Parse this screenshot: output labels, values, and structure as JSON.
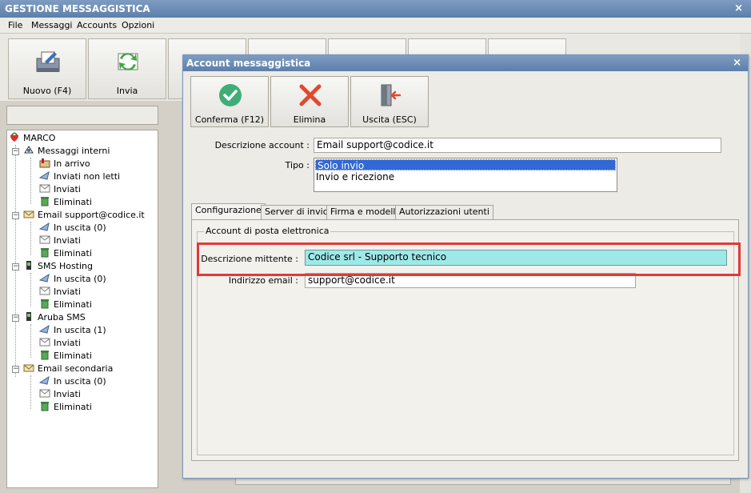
{
  "main_window": {
    "title": "GESTIONE MESSAGGISTICA",
    "close_label": "×"
  },
  "menu": [
    "File",
    "Messaggi",
    "Accounts",
    "Opzioni"
  ],
  "toolbar": {
    "new_label": "Nuovo (F4)",
    "send_label": "Invia"
  },
  "tree": {
    "root": "MARCO",
    "groups": [
      {
        "label": "Messaggi interni",
        "children": [
          "In arrivo",
          "Inviati non letti",
          "Inviati",
          "Eliminati"
        ]
      },
      {
        "label": "Email support@codice.it",
        "children": [
          "In uscita (0)",
          "Inviati",
          "Eliminati"
        ]
      },
      {
        "label": "SMS Hosting",
        "children": [
          "In uscita (0)",
          "Inviati",
          "Eliminati"
        ]
      },
      {
        "label": "Aruba SMS",
        "children": [
          "In uscita (1)",
          "Inviati",
          "Eliminati"
        ]
      },
      {
        "label": "Email secondaria",
        "children": [
          "In uscita (0)",
          "Inviati",
          "Eliminati"
        ]
      }
    ]
  },
  "dialog": {
    "title": "Account messaggistica",
    "close_label": "×",
    "buttons": {
      "confirm_label": "Conferma (F12)",
      "delete_label": "Elimina",
      "exit_label": "Uscita (ESC)"
    },
    "fields": {
      "descrizione_account_label": "Descrizione account :",
      "descrizione_account_value": "Email support@codice.it",
      "tipo_label": "Tipo :",
      "tipo_options": [
        "Solo invio",
        "Invio e ricezione"
      ],
      "tipo_selected": "Solo invio"
    },
    "tabs": [
      "Configurazione",
      "Server di invio",
      "Firma e modelli",
      "Autorizzazioni utenti"
    ],
    "active_tab": "Configurazione",
    "group_title": "Account di posta elettronica",
    "mittente_label": "Descrizione mittente :",
    "mittente_value": "Codice srl - Supporto tecnico",
    "email_label": "Indirizzo email :",
    "email_value": "support@codice.it"
  },
  "colors": {
    "title_bar": "#6b8cb8",
    "highlight_border": "#e03a3a",
    "focused_input": "#9fe8e8",
    "selection": "#3168d5"
  }
}
